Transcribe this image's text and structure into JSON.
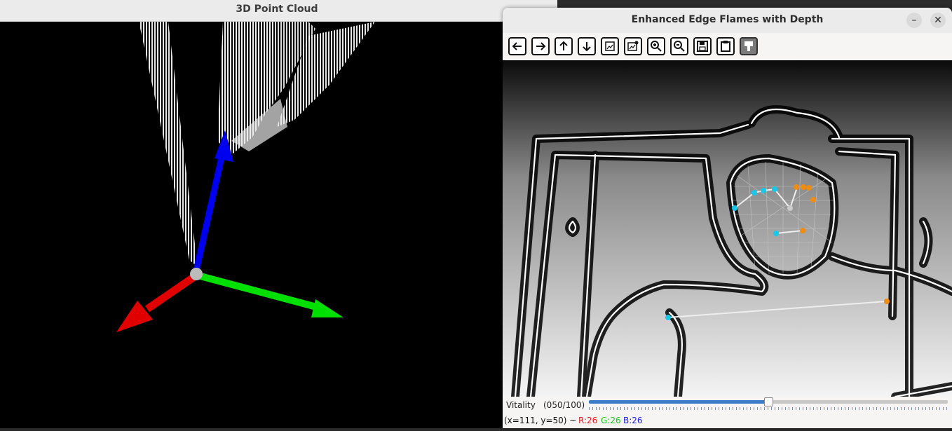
{
  "left_window": {
    "title": "3D Point Cloud",
    "axis_colors": {
      "x": "#e00000",
      "y": "#00e000",
      "z": "#0000f0"
    }
  },
  "right_window": {
    "title": "Enhanced Edge Flames with Depth",
    "window_buttons": {
      "minimize": "–",
      "close": "✕"
    },
    "toolbar": [
      {
        "icon": "arrow-left-icon"
      },
      {
        "icon": "arrow-right-icon"
      },
      {
        "icon": "arrow-up-icon"
      },
      {
        "icon": "arrow-down-icon"
      },
      {
        "icon": "image-icon"
      },
      {
        "icon": "image-edit-icon"
      },
      {
        "icon": "zoom-in-icon"
      },
      {
        "icon": "zoom-out-icon"
      },
      {
        "icon": "save-icon"
      },
      {
        "icon": "clipboard-icon"
      },
      {
        "icon": "brush-icon"
      }
    ],
    "trackbar": {
      "label": "Vitality",
      "value_text": "(050/100)",
      "value": 50,
      "max": 100
    },
    "status": {
      "coords": "(x=111, y=50) ~",
      "r": "R:26",
      "g": "G:26",
      "b": "B:26"
    },
    "landmark_colors": {
      "left": "#18c8e8",
      "right": "#f08c10"
    }
  }
}
